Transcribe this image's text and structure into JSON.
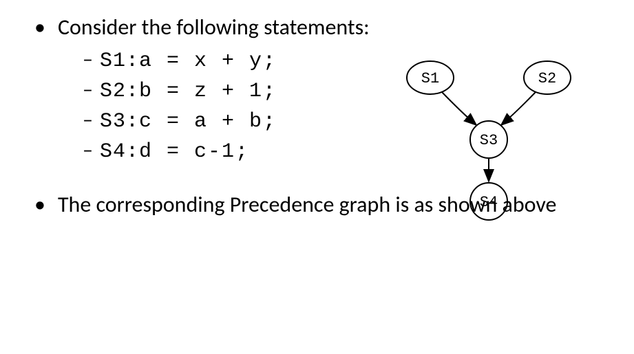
{
  "bullet1": "Consider the following statements:",
  "statements": [
    {
      "label": "S1:",
      "code": " a = x + y;"
    },
    {
      "label": "S2:",
      "code": " b = z + 1;"
    },
    {
      "label": "S3:",
      "code": " c = a + b;"
    },
    {
      "label": "S4:",
      "code": " d = c-1;"
    }
  ],
  "bullet2": "The corresponding Precedence graph is as shown above",
  "graph": {
    "nodes": {
      "s1": "S1",
      "s2": "S2",
      "s3": "S3",
      "s4": "S4"
    }
  }
}
